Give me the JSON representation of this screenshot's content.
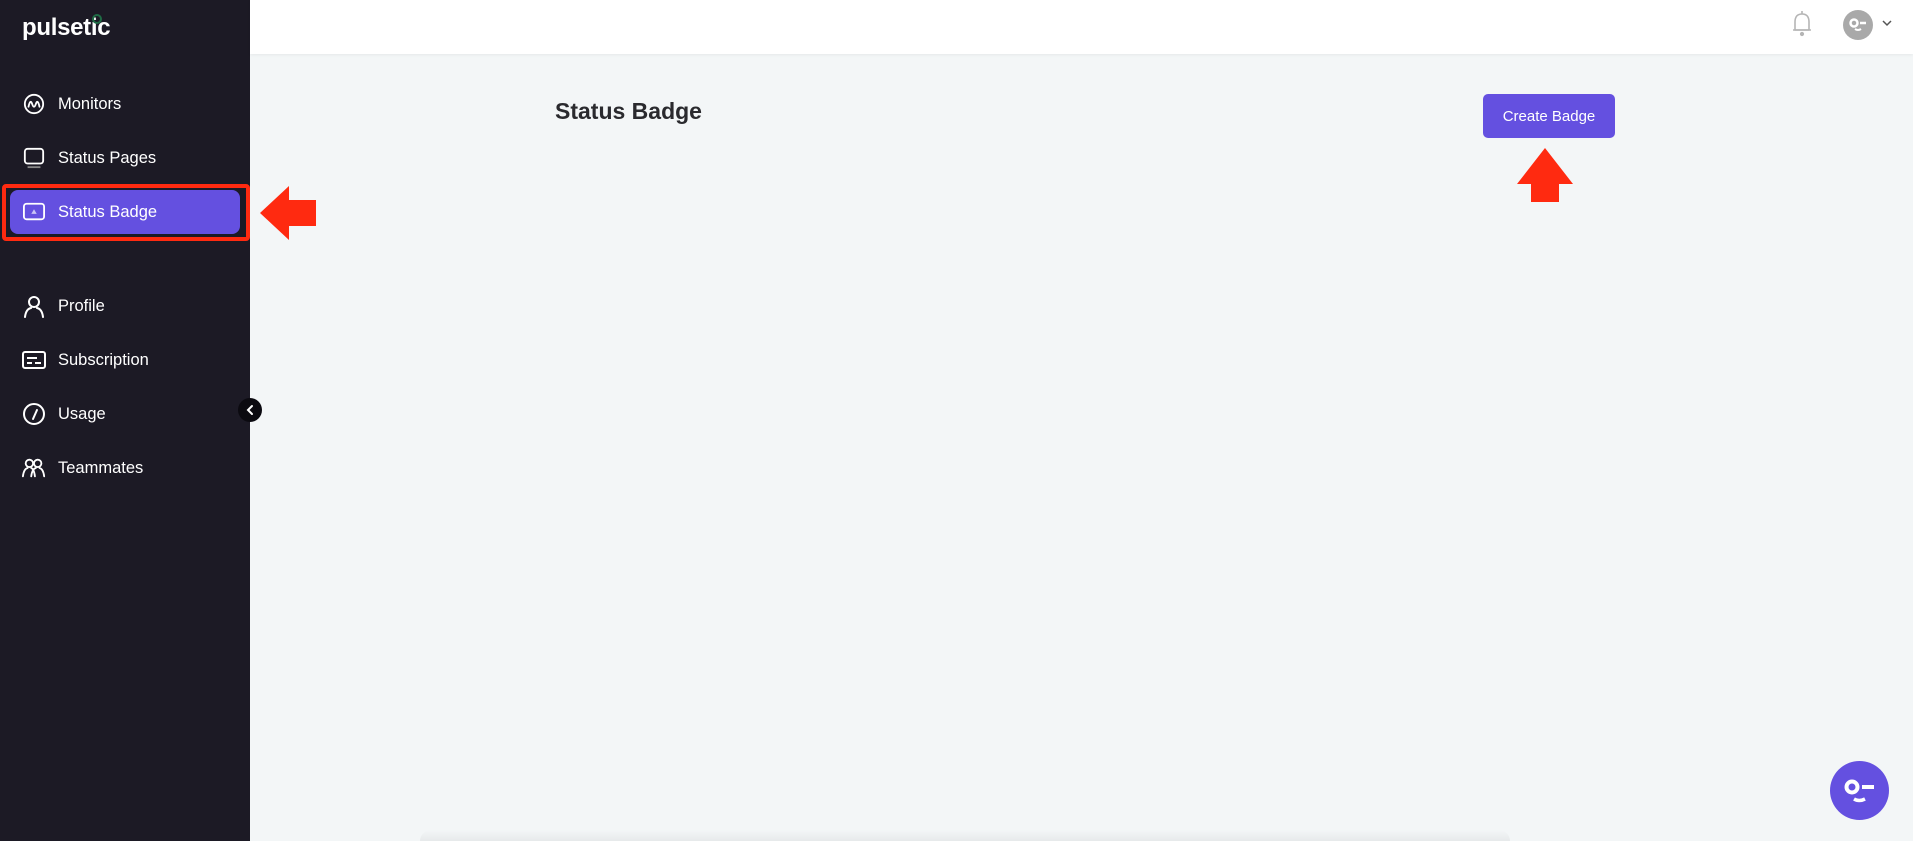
{
  "app": {
    "brand": "pulsetic"
  },
  "sidebar": {
    "items": [
      {
        "label": "Monitors",
        "icon": "monitor-pulse-icon"
      },
      {
        "label": "Status Pages",
        "icon": "status-pages-icon"
      },
      {
        "label": "Status Badge",
        "icon": "status-badge-icon",
        "active": true
      },
      {
        "label": "Profile",
        "icon": "user-icon"
      },
      {
        "label": "Subscription",
        "icon": "credit-card-icon"
      },
      {
        "label": "Usage",
        "icon": "gauge-icon"
      },
      {
        "label": "Teammates",
        "icon": "users-icon"
      }
    ],
    "collapse_icon": "chevron-left-icon"
  },
  "header": {
    "notification_icon": "bell-icon",
    "avatar_icon": "avatar-icon",
    "menu_icon": "chevron-down-icon"
  },
  "main": {
    "title": "Status Badge",
    "create_button_label": "Create Badge"
  },
  "annotations": {
    "arrow_color": "#ff2a10",
    "highlight_target": "Status Badge"
  },
  "colors": {
    "accent": "#6450e0",
    "sidebar_bg": "#1c1a25",
    "page_bg": "#f3f6f7"
  },
  "chat_widget": {
    "icon": "chat-face-icon"
  }
}
